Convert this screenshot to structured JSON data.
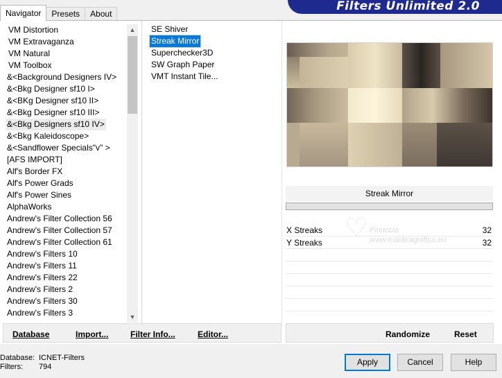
{
  "tabs": [
    {
      "label": "Navigator",
      "active": true
    },
    {
      "label": "Presets",
      "active": false
    },
    {
      "label": "About",
      "active": false
    }
  ],
  "banner": {
    "title": "Filters Unlimited 2.0"
  },
  "categories": {
    "selected_index": 8,
    "items": [
      "VM Distortion",
      "VM Extravaganza",
      "VM Natural",
      "VM Toolbox",
      "&<Background Designers IV>",
      "&<Bkg Designer sf10 I>",
      "&<BKg Designer sf10 II>",
      "&<Bkg Designer sf10 III>",
      "&<Bkg Designers sf10 IV>",
      "&<Bkg Kaleidoscope>",
      "&<Sandflower Specials\"v\" >",
      "[AFS IMPORT]",
      "Alf's Border FX",
      "Alf's Power Grads",
      "Alf's Power Sines",
      "AlphaWorks",
      "Andrew's Filter Collection 56",
      "Andrew's Filter Collection 57",
      "Andrew's Filter Collection 61",
      "Andrew's Filters 10",
      "Andrew's Filters 11",
      "Andrew's Filters 22",
      "Andrew's Filters 2",
      "Andrew's Filters 30",
      "Andrew's Filters 3"
    ]
  },
  "filters": {
    "selected_index": 1,
    "items": [
      "SE Shiver",
      "Streak Mirror",
      "Superchecker3D",
      "SW Graph Paper",
      "VMT Instant Tile..."
    ]
  },
  "preview": {
    "filter_name": "Streak Mirror"
  },
  "params": [
    {
      "label": "X Streaks",
      "value": "32"
    },
    {
      "label": "Y Streaks",
      "value": "32"
    }
  ],
  "watermark": {
    "name": "Pinuccia",
    "url": "www.maidiragrafica.eu"
  },
  "bottom_left_buttons": [
    {
      "label": "Database",
      "underline_char": "D"
    },
    {
      "label": "Import...",
      "underline_char": "I"
    },
    {
      "label": "Filter Info...",
      "underline_char": "F"
    },
    {
      "label": "Editor...",
      "underline_char": "E"
    }
  ],
  "bottom_right_buttons": [
    {
      "label": "Randomize"
    },
    {
      "label": "Reset"
    }
  ],
  "footer": {
    "database_label": "Database:",
    "database_value": "ICNET-Filters",
    "filters_label": "Filters:",
    "filters_value": "794"
  },
  "dialog_buttons": {
    "apply": "Apply",
    "cancel": "Cancel",
    "help": "Help"
  }
}
